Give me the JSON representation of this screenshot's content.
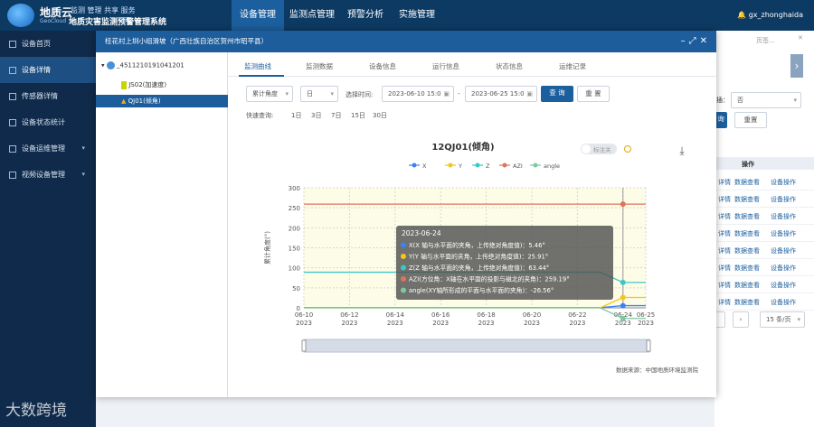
{
  "header": {
    "brand": "地质云",
    "slogan": "监测 管理 共享 服务",
    "brand_en": "GeoCloud",
    "system": "地质灾害监测预警管理系统",
    "nav": [
      "设备管理",
      "监测点管理",
      "预警分析",
      "实施管理"
    ],
    "user": "gx_zhonghaida"
  },
  "sidebar": {
    "items": [
      {
        "label": "设备首页"
      },
      {
        "label": "设备详情"
      },
      {
        "label": "传感器详情"
      },
      {
        "label": "设备状态统计"
      },
      {
        "label": "设备运维管理"
      },
      {
        "label": "视频设备管理"
      }
    ]
  },
  "watermark": "大数跨境",
  "background": {
    "page_size": "页签...",
    "select_label": "插：",
    "select_value": "否",
    "btn_search": "询",
    "btn_reset": "重置",
    "col_action": "操作",
    "row_links": [
      "详情",
      "数据查看",
      "设备操作"
    ],
    "pager": "15 条/页"
  },
  "modal": {
    "title": "桂花村上圳小组滑坡（广西壮族自治区贺州市昭平县）",
    "tree": {
      "root": "_4511210191041201",
      "children": [
        "JS02(加速度)",
        "QJ01(倾角)"
      ]
    },
    "tabs": [
      "监测曲线",
      "监测数据",
      "设备信息",
      "运行信息",
      "状态信息",
      "运维记录"
    ],
    "filters": {
      "metric": "累计角度",
      "period": "日",
      "time_label": "选择时间:",
      "start": "2023-06-10 15:0",
      "end": "2023-06-25 15:0",
      "sep": "-",
      "query": "查 询",
      "reset": "重 置",
      "quick_label": "快速查询:",
      "quick": [
        "1日",
        "3日",
        "7日",
        "15日",
        "30日"
      ]
    }
  },
  "chart_data": {
    "type": "line",
    "title": "12QJ01(倾角)",
    "toggle_label": "标注关",
    "ylabel": "累计角度(°)",
    "ylim": [
      0,
      300
    ],
    "yticks": [
      0,
      50,
      100,
      150,
      200,
      250,
      300
    ],
    "xticks": [
      "06-10\n2023",
      "06-12\n2023",
      "06-14\n2023",
      "06-16\n2023",
      "06-18\n2023",
      "06-20\n2023",
      "06-22\n2023",
      "06-24\n2023",
      "06-25\n2023"
    ],
    "legend": [
      "X",
      "Y",
      "Z",
      "AZI",
      "angle"
    ],
    "colors": {
      "X": "#3b82f6",
      "Y": "#f5c518",
      "Z": "#3cc7c7",
      "AZI": "#e0735c",
      "angle": "#7dc8a0"
    },
    "series": [
      {
        "name": "X",
        "values": [
          [
            10,
            0.5
          ],
          [
            23,
            0.5
          ],
          [
            24,
            5.46
          ],
          [
            25,
            5.46
          ]
        ]
      },
      {
        "name": "Y",
        "values": [
          [
            10,
            0
          ],
          [
            23,
            0
          ],
          [
            24,
            25.91
          ],
          [
            25,
            25.91
          ]
        ]
      },
      {
        "name": "Z",
        "values": [
          [
            10,
            89
          ],
          [
            23,
            89
          ],
          [
            24,
            63.44
          ],
          [
            25,
            63.44
          ]
        ]
      },
      {
        "name": "AZI",
        "values": [
          [
            10,
            259.19
          ],
          [
            25,
            259.19
          ]
        ]
      },
      {
        "name": "angle",
        "values": [
          [
            10,
            0
          ],
          [
            23,
            0
          ],
          [
            24,
            -26.56
          ],
          [
            25,
            -26.56
          ]
        ]
      }
    ],
    "tooltip": {
      "date": "2023-06-24",
      "lines": [
        "X(X 轴与水平面的夹角，上传绝对角度值)：5.46°",
        "Y(Y 轴与水平面的夹角，上传绝对角度值)：25.91°",
        "Z(Z 轴与水平面的夹角，上传绝对角度值)：63.44°",
        "AZI(方位角：X轴在水平面的投影与磁北的夹角)：259.19°",
        "angle(XY轴所形成的平面与水平面的夹角)：-26.56°"
      ]
    },
    "source": "数据来源：中国地质环境监测院"
  }
}
